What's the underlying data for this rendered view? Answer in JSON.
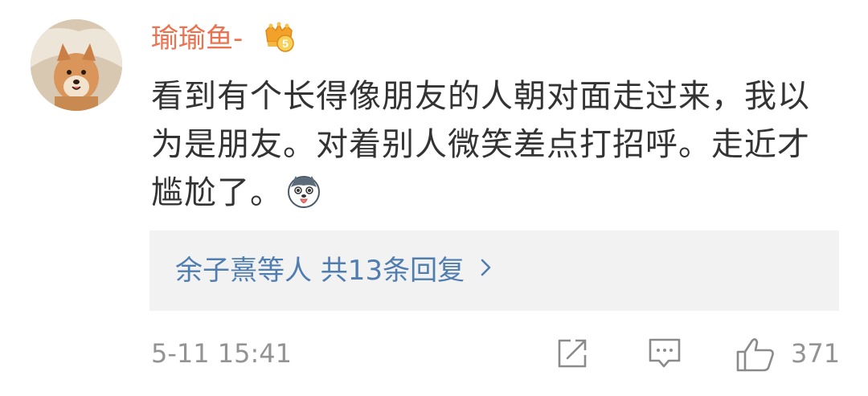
{
  "comment": {
    "username": "瑜瑜鱼-",
    "badge_icon": "crown-level-5-icon",
    "badge_level": "5",
    "text": "看到有个长得像朋友的人朝对面走过来，我以为是朋友。对着别人微笑差点打招呼。走近才尴尬了。",
    "emoji_icon": "husky-tongue-emoji",
    "reply_summary": "余子熹等人 共13条回复",
    "reply_chevron": "›",
    "timestamp": "5-11 15:41",
    "like_count": "371"
  },
  "colors": {
    "username": "#eb7350",
    "link": "#507daf",
    "meta": "#939393",
    "reply_bg": "#f2f2f2"
  },
  "actions": {
    "share_icon": "share-icon",
    "comment_icon": "comment-icon",
    "like_icon": "thumbs-up-icon"
  }
}
